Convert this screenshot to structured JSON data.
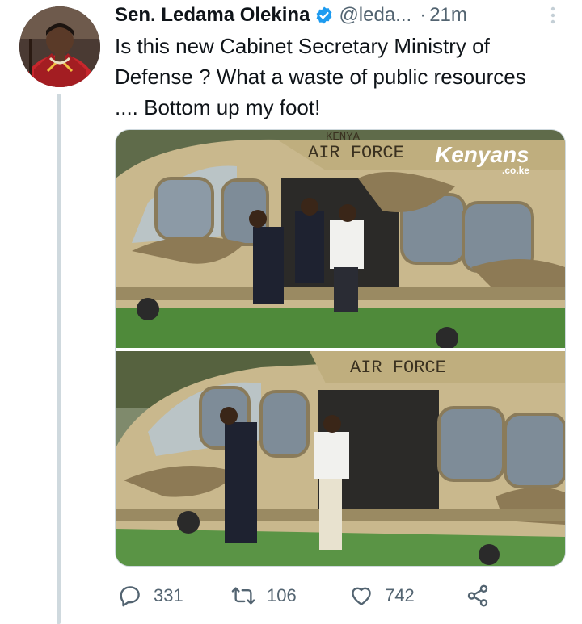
{
  "tweet": {
    "author_name": "Sen. Ledama Olekina",
    "handle": "@leda...",
    "separator": "·",
    "time": "21m",
    "text": "Is this new Cabinet Secretary Ministry of\nDefense ? What a waste of public resources\n.... Bottom up my foot!"
  },
  "media": {
    "heli_marking_top_partial": "KENYA",
    "heli_marking": "AIR FORCE",
    "watermark_main": "Kenyans",
    "watermark_sub": ".co.ke"
  },
  "actions": {
    "replies": "331",
    "retweets": "106",
    "likes": "742"
  },
  "colors": {
    "verified_blue": "#1d9bf0",
    "secondary_text": "#536471",
    "thread_line": "#cfd9de"
  }
}
